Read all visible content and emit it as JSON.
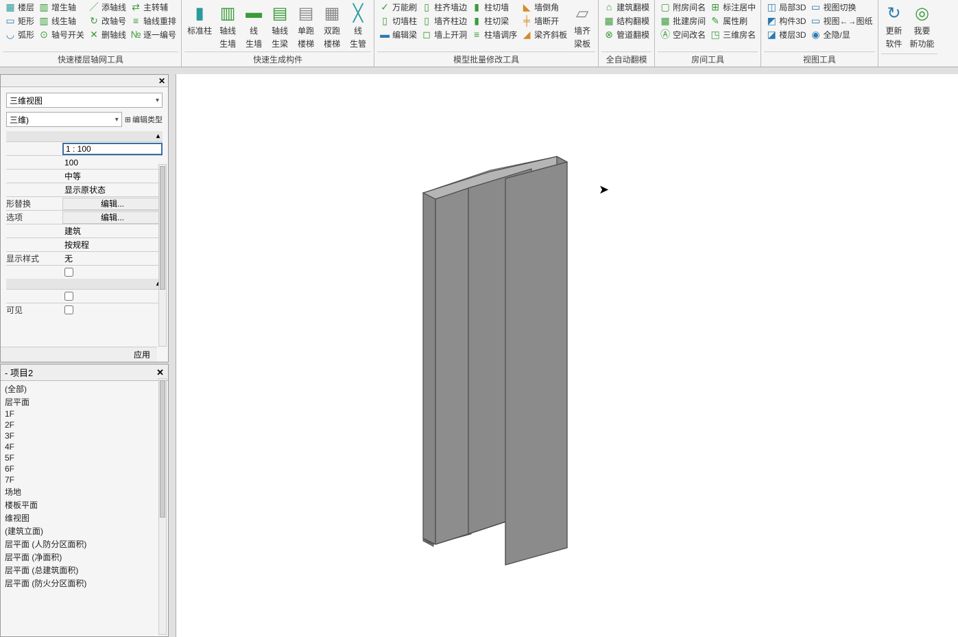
{
  "ribbon": {
    "g1": {
      "label": "快速楼层轴网工具",
      "c1": [
        "楼层",
        "矩形",
        "弧形"
      ],
      "c2": [
        "增生轴",
        "线生轴",
        "轴号开关"
      ],
      "c3": [
        "添轴线",
        "改轴号",
        "删轴线"
      ],
      "c4": [
        "主转辅",
        "轴线重排",
        "逐一编号"
      ]
    },
    "g2": {
      "label": "快速生成构件",
      "big": [
        {
          "l1": "标准柱"
        },
        {
          "l1": "轴线",
          "l2": "生墙"
        },
        {
          "l1": "线",
          "l2": "生墙"
        },
        {
          "l1": "轴线",
          "l2": "生梁"
        },
        {
          "l1": "单跑",
          "l2": "楼梯"
        },
        {
          "l1": "双跑",
          "l2": "楼梯"
        },
        {
          "l1": "线",
          "l2": "生管"
        }
      ]
    },
    "g3": {
      "label": "模型批量修改工具",
      "c1": [
        "万能刷",
        "切墙柱",
        "编辑梁"
      ],
      "c2": [
        "柱齐墙边",
        "墙齐柱边",
        "墙上开洞"
      ],
      "c3": [
        "柱切墙",
        "柱切梁",
        "柱墙调序"
      ],
      "c4": [
        "墙倒角",
        "墙断开",
        "梁齐斜板"
      ],
      "big": {
        "l1": "墙齐",
        "l2": "梁板"
      }
    },
    "g4": {
      "label": "全自动翻模",
      "items": [
        "建筑翻模",
        "结构翻模",
        "管道翻模"
      ]
    },
    "g5": {
      "label": "房间工具",
      "c1": [
        "附房间名",
        "批建房间",
        "空间改名"
      ],
      "c2": [
        "标注居中",
        "属性刷",
        "三维房名"
      ]
    },
    "g6": {
      "label": "视图工具",
      "c1": [
        "局部3D",
        "构件3D",
        "楼层3D"
      ],
      "c2": [
        "视图切换",
        "视图←→图纸",
        "全隐/显"
      ]
    },
    "g7": {
      "big": [
        {
          "l1": "更新",
          "l2": "软件"
        },
        {
          "l1": "我要",
          "l2": "新功能"
        }
      ]
    }
  },
  "props": {
    "view_type": "三维视图",
    "view_name": "三维)",
    "edit_type": "编辑类型",
    "rows": {
      "scale": "1 : 100",
      "scale_val": "100",
      "detail": "中等",
      "visibility": "显示原状态",
      "override_k": "形替换",
      "override_v": "编辑...",
      "option_k": "选项",
      "option_v": "编辑...",
      "discipline": "建筑",
      "hidden": "按规程",
      "style_k": "显示样式",
      "style_v": "无",
      "vis_k": "可见"
    },
    "apply": "应用"
  },
  "browser": {
    "title": "- 项目2",
    "nodes": [
      "(全部)",
      "层平面",
      "1F",
      "2F",
      "3F",
      "4F",
      "5F",
      "6F",
      "7F",
      "场地",
      "楼板平面",
      "维视图",
      "(建筑立面)",
      "层平面 (人防分区面积)",
      "层平面 (净面积)",
      "层平面 (总建筑面积)",
      "层平面 (防火分区面积)"
    ]
  }
}
